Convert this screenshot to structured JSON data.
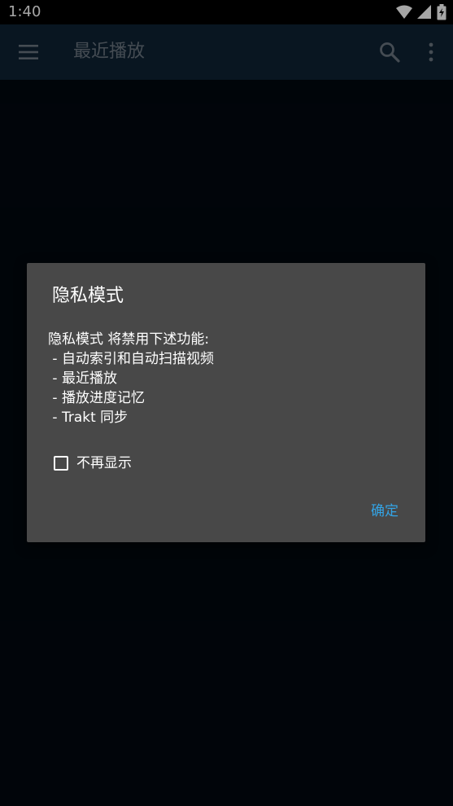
{
  "status_bar": {
    "time": "1:40",
    "icons": [
      "wifi-icon",
      "signal-icon",
      "battery-charging-icon"
    ]
  },
  "app_bar": {
    "title": "最近播放",
    "icons": [
      "menu-icon",
      "search-icon",
      "more-vert-icon"
    ]
  },
  "dialog": {
    "title": "隐私模式",
    "message_lines": [
      "隐私模式 将禁用下述功能:",
      " - 自动索引和自动扫描视频",
      " - 最近播放",
      " - 播放进度记忆",
      " - Trakt 同步"
    ],
    "checkbox": {
      "label": "不再显示",
      "checked": false
    },
    "ok_label": "确定"
  },
  "colors": {
    "app_bar_bg": "#0e2233",
    "background": "#01080f",
    "dialog_bg": "#484848",
    "accent": "#33a4e6"
  }
}
